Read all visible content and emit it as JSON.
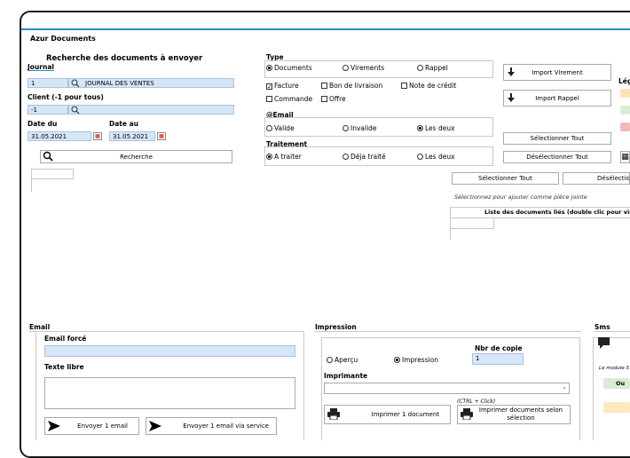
{
  "window": {
    "title": "Azur Documents"
  },
  "search": {
    "heading": "Recherche des documents à envoyer",
    "journal_label": "Journal",
    "journal_code": "1",
    "journal_name": "JOURNAL DES VENTES",
    "client_label": "Client (-1 pour tous)",
    "client_value": "-1",
    "date_from_label": "Date du",
    "date_from_value": "31.05.2021",
    "date_to_label": "Date au",
    "date_to_value": "31.05.2021",
    "search_button": "Recherche"
  },
  "type": {
    "label": "Type",
    "options": [
      "Documents",
      "Virements",
      "Rappel"
    ],
    "selected": "Documents",
    "doc_checks": [
      {
        "label": "Facture",
        "checked": true
      },
      {
        "label": "Bon de livraison",
        "checked": false
      },
      {
        "label": "Note de crédit",
        "checked": false
      },
      {
        "label": "Commande",
        "checked": false
      },
      {
        "label": "Offre",
        "checked": false
      }
    ]
  },
  "email_filter": {
    "label": "@Email",
    "options": [
      "Valide",
      "Invalide",
      "Les deux"
    ],
    "selected": "Les deux"
  },
  "traitement": {
    "label": "Traitement",
    "options": [
      "A traiter",
      "Déja traité",
      "Les deux"
    ],
    "selected": "A traiter"
  },
  "actions": {
    "import_virement": "Import Virement",
    "import_rappel": "Import Rappel",
    "select_all": "Sélectionner Tout",
    "deselect_all": "Désélectionner Tout",
    "legend_label": "Lég"
  },
  "attachments": {
    "select_all": "Sélectionner Tout",
    "deselect_all": "Désélectionner",
    "hint": "Sélectionnez pour ajouter comme pièce jointe",
    "linked_header": "Liste des documents liés (double clic pour vis"
  },
  "email": {
    "section": "Email",
    "forced_label": "Email forcé",
    "free_text_label": "Texte libre",
    "send_button": "Envoyer 1 email",
    "send_service_button": "Envoyer 1 email via service"
  },
  "impression": {
    "section": "Impression",
    "options": [
      "Aperçu",
      "Impression"
    ],
    "selected": "Impression",
    "copies_label": "Nbr de copie",
    "copies_value": "1",
    "printer_label": "Imprimante",
    "print_one": "Imprimer 1 document",
    "ctrl_hint": "(CTRL + Click)",
    "print_selection": "Imprimer documents selon sélection"
  },
  "sms": {
    "section": "Sms",
    "module_text": "Le module S",
    "status_text": "Ou"
  },
  "colors": {
    "accent": "#1f8fd0",
    "input_bg": "#d6e6f7",
    "legend_orange": "#fde3b5",
    "legend_green": "#d7eed2",
    "legend_red": "#f5b8b8"
  }
}
